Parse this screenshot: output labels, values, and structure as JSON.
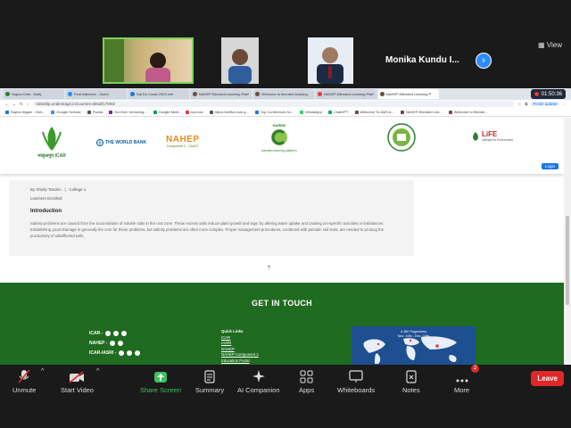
{
  "zoom": {
    "view_label": "View",
    "active_speaker_name": "Monika Kundu I...",
    "toolbar": {
      "mute_label": "Unmute",
      "video_label": "Start Video",
      "share_label": "Share Screen",
      "summary_label": "Summary",
      "companion_label": "AI Companion",
      "apps_label": "Apps",
      "whiteboards_label": "Whiteboards",
      "notes_label": "Notes",
      "more_label": "More",
      "more_badge": "2",
      "leave_label": "Leave"
    }
  },
  "browser": {
    "tabs": [
      {
        "label": "Sapna Chel - Daily",
        "color": "#2e7d32"
      },
      {
        "label": "Post Attendee - Zoom",
        "color": "#2d8cff"
      },
      {
        "label": "Sai Do Coast 2023.xml",
        "color": "#1a73e8"
      },
      {
        "label": "NAHEP-Blended Learning Platf",
        "color": "#6d4c41"
      },
      {
        "label": "Welcome to blended learning",
        "color": "#6d4c41"
      },
      {
        "label": "NAHEP-Blended Learning Platf",
        "color": "#e53935"
      },
      {
        "label": "NAHEP-Blended Learning P",
        "color": "#6d4c41"
      }
    ],
    "recording_time": "01:50:36",
    "url": "naheblp.ondimeagri.in/courses-detail/17694/",
    "finish_update": "Finish update",
    "bookmarks": [
      "Sapna Nigam - Onli...",
      "Google Scholar",
      "Panda",
      "Sci-Hub: removing...",
      "Google Meet",
      "icar-icar",
      "https://sellfox-icar-g...",
      "Top Conference-Sc...",
      "WhatsApp",
      "ChatGPT",
      "Welcome To AMS A...",
      "NAHEP-Blended Lea...",
      "Welcome to Blende..."
    ]
  },
  "site": {
    "logos": {
      "icar": "भाकृअनुप ICAR",
      "world_bank": "THE WORLD BANK",
      "nahep": "NAHEP",
      "nahep_sub": "Component 2 - CAAST",
      "nareb": "NAREB",
      "nareb_sub": "blended learning platform",
      "life": "LiFE",
      "life_sub": "Lifestyle for Environment"
    },
    "login_label": "Login",
    "course": {
      "byline": "By Shaily Tandon",
      "college": "College 1",
      "learners": "Learners Enrolled",
      "intro_heading": "Introduction",
      "intro_text": "Salinity problems are caused from the accumulation of soluble salts in the root zone. These excess salts reduce plant growth and vigor by altering water uptake and causing ion-specific toxicities or imbalances. Establishing good drainage is generally the cure for these problems, but salinity problems are often more complex. Proper management procedures, combined with periodic soil tests, are needed to prolong the productivity of saltaffected soils."
    },
    "footer": {
      "heading": "GET IN TOUCH",
      "social": [
        "ICAR -",
        "NAHEP -",
        "ICAR-IASRI -"
      ],
      "quick_links_heading": "Quick Links",
      "quick_links": [
        "ICAR",
        "IASRI",
        "NAHEP",
        "NAHEP Component 2",
        "Education Portal"
      ],
      "map_line1": "4,380 Pageviews",
      "map_line2": "Nov. 10th - Dec. 10th"
    }
  },
  "colors": {
    "zoom_bg": "#1a1a1a",
    "footer_green": "#1f6b1f",
    "share_green": "#3ec15c",
    "leave_red": "#e02828",
    "link_blue": "#1a73e8"
  }
}
